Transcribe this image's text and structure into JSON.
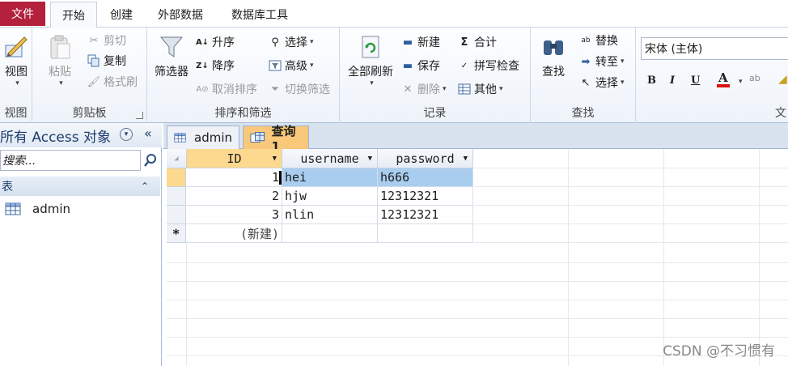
{
  "tabs": {
    "file": "文件",
    "items": [
      "开始",
      "创建",
      "外部数据",
      "数据库工具"
    ]
  },
  "ribbon": {
    "views": {
      "view": "视图",
      "label": "视图"
    },
    "clipboard": {
      "paste": "粘贴",
      "cut": "剪切",
      "copy": "复制",
      "format_painter": "格式刷",
      "label": "剪贴板"
    },
    "sort_filter": {
      "filter": "筛选器",
      "ascending": "升序",
      "descending": "降序",
      "remove_sort": "取消排序",
      "selection": "选择",
      "advanced": "高级",
      "toggle_filter": "切换筛选",
      "label": "排序和筛选"
    },
    "records": {
      "refresh_all": "全部刷新",
      "new": "新建",
      "save": "保存",
      "delete": "删除",
      "totals": "合计",
      "spelling": "拼写检查",
      "more": "其他",
      "label": "记录"
    },
    "find": {
      "find": "查找",
      "replace": "替换",
      "goto": "转至",
      "select": "选择",
      "label": "查找"
    },
    "text_formatting": {
      "font": "宋体 (主体)",
      "bold": "B",
      "italic": "I",
      "underline": "U",
      "font_color": "A",
      "label_partial": "文"
    }
  },
  "nav": {
    "title": "所有 Access 对象",
    "search_placeholder": "搜索...",
    "category": "表",
    "items": [
      "admin"
    ]
  },
  "doc_tabs": [
    {
      "label": "admin",
      "active": false
    },
    {
      "label": "查询1",
      "active": true
    }
  ],
  "grid": {
    "columns": [
      "ID",
      "username",
      "password"
    ],
    "rows": [
      {
        "id": "1",
        "username": "hei",
        "password": "h666"
      },
      {
        "id": "2",
        "username": "hjw",
        "password": "12312321"
      },
      {
        "id": "3",
        "username": "nlin",
        "password": "12312321"
      }
    ],
    "new_row_marker": "*",
    "new_row_label": "(新建)"
  },
  "watermark": "CSDN @不习惯有",
  "colors": {
    "file_tab": "#b3213c",
    "active_doc_tab": "#f9c87a",
    "selected_row": "#a9cdef",
    "id_header": "#fcd98f"
  }
}
